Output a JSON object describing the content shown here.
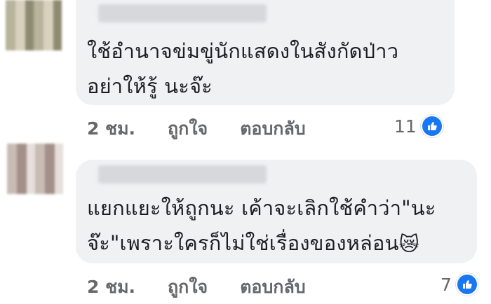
{
  "comments": [
    {
      "text_line1": "ใช้อำนาจข่มขู่นักแสดงในสังกัดป่าว",
      "text_line2": "อย่าให้รู้ นะจ๊ะ",
      "time": "2 ชม.",
      "like_label": "ถูกใจ",
      "reply_label": "ตอบกลับ",
      "reaction_count": "11"
    },
    {
      "text_line1": "แยกแยะให้ถูกนะ เค้าจะเลิกใช้คำว่า\"นะ",
      "text_line2": "จ๊ะ\"เพราะใครก็ไม่ใช่เรื่องของหล่อน",
      "emoji": "😿",
      "time": "2 ชม.",
      "like_label": "ถูกใจ",
      "reply_label": "ตอบกลับ",
      "reaction_count": "7"
    }
  ],
  "colors": {
    "bubble": "#eff1f3",
    "text": "#1c1e21",
    "meta": "#65676b",
    "like": "#1877f2"
  },
  "icons": {
    "reaction": "thumbs-up-icon"
  }
}
